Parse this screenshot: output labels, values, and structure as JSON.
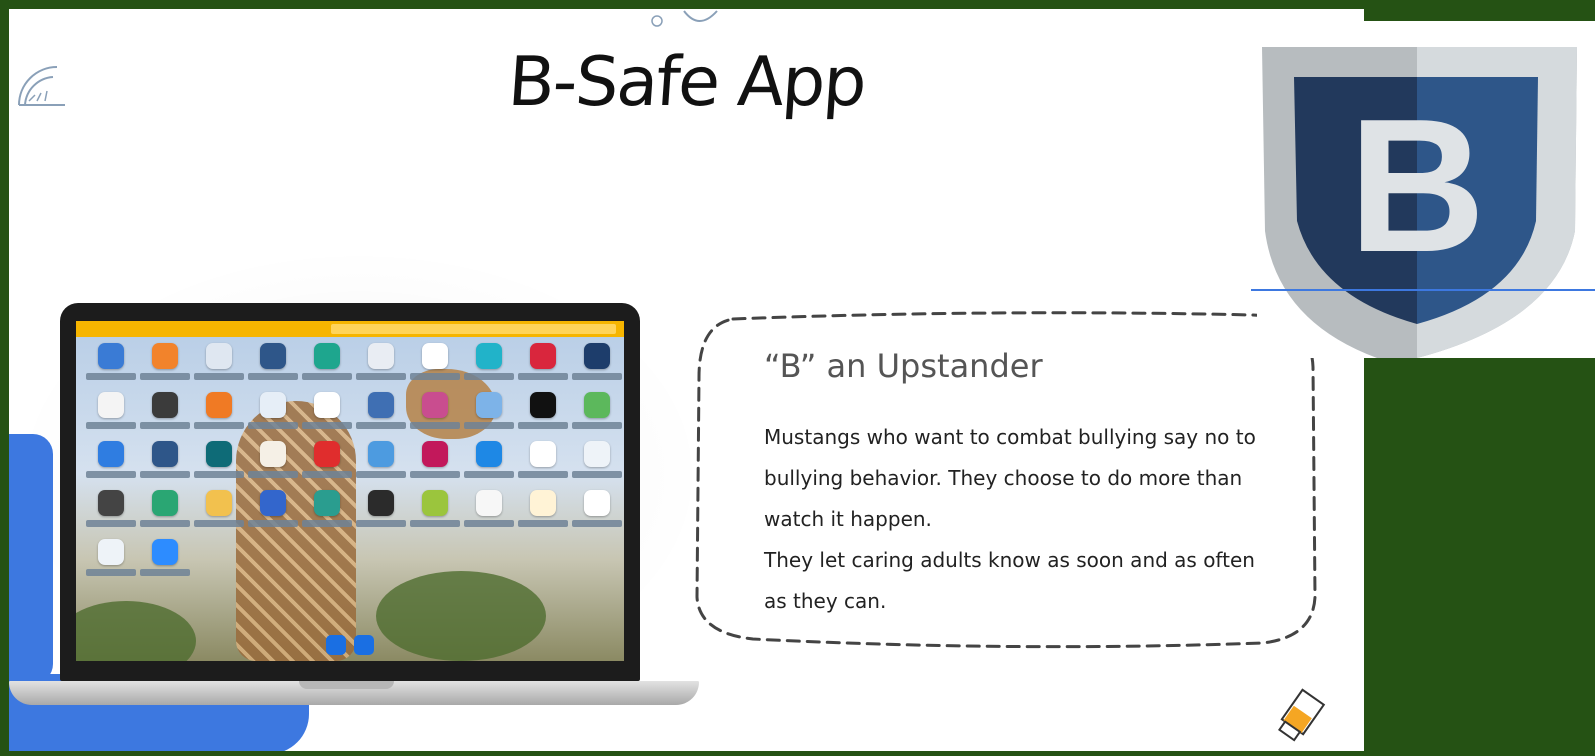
{
  "slide": {
    "title": "B-Safe App"
  },
  "card": {
    "heading": "“B” an Upstander",
    "paragraphs": [
      "Mustangs who want to combat bullying say no to bullying behavior. They choose to do more than watch it happen.",
      "They let caring adults know as soon and as often as they can."
    ]
  },
  "logo": {
    "letter": "B",
    "icon": "shield-b-logo"
  },
  "colors": {
    "frame_green": "#255214",
    "accent_blue": "#3d78e0",
    "shield_dark": "#22395c",
    "shield_light": "#2e5689",
    "shield_grey": "#b7bcbf"
  },
  "laptop": {
    "icon": "laptop-screenshot"
  }
}
